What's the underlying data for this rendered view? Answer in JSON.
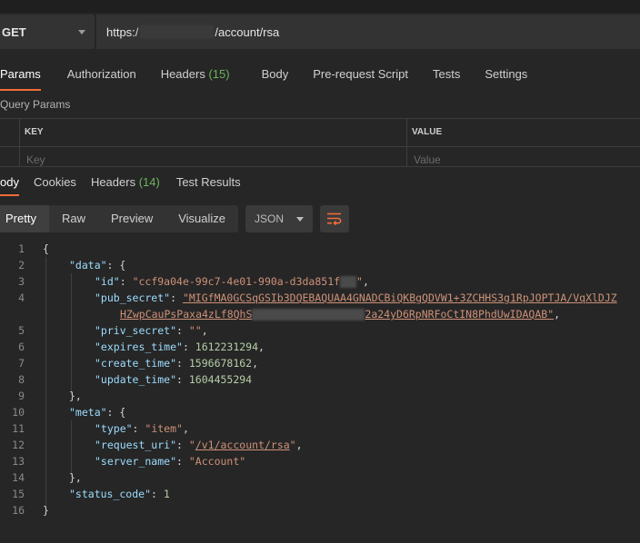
{
  "request": {
    "method": "GET",
    "url_prefix": "https:/",
    "url_suffix": "/account/rsa"
  },
  "request_tabs": [
    {
      "label": "Params",
      "active": true
    },
    {
      "label": "Authorization"
    },
    {
      "label": "Headers",
      "count": "(15)"
    },
    {
      "label": "Body"
    },
    {
      "label": "Pre-request Script"
    },
    {
      "label": "Tests"
    },
    {
      "label": "Settings"
    }
  ],
  "query_params": {
    "title": "Query Params",
    "key_header": "KEY",
    "value_header": "VALUE",
    "key_placeholder": "Key",
    "value_placeholder": "Value"
  },
  "response_tabs": [
    {
      "label": "ody",
      "active": true
    },
    {
      "label": "Cookies"
    },
    {
      "label": "Headers",
      "count": "(14)"
    },
    {
      "label": "Test Results"
    }
  ],
  "view_modes": [
    "Pretty",
    "Raw",
    "Preview",
    "Visualize"
  ],
  "format": "JSON",
  "code": {
    "line_numbers": [
      "1",
      "2",
      "3",
      "4",
      "5",
      "6",
      "7",
      "8",
      "9",
      "10",
      "11",
      "12",
      "13",
      "14",
      "15",
      "16"
    ],
    "l1": "{",
    "l2_key": "\"data\"",
    "l2_rest": ": {",
    "l3_key": "\"id\"",
    "l3_sep": ": ",
    "l3_val_a": "\"ccf9a04e-99c7-4e01-990a-d3da851f",
    "l3_val_b": "\"",
    "l3_end": ",",
    "l4_key": "\"pub_secret\"",
    "l4_sep": ": ",
    "l4_val": "\"MIGfMA0GCSqGSIb3DQEBAQUAA4GNADCBiQKBgQDVW1+3ZCHHS3g1RpJOPTJA/VqXlDJZ",
    "l4b_val_a": "HZwpCauPsPaxa4zLf8QhS",
    "l4b_val_b": "2a24yD6RpNRFoCtIN8PhdUwIDAQAB\"",
    "l4b_end": ",",
    "l5_key": "\"priv_secret\"",
    "l5_sep": ": ",
    "l5_val": "\"\"",
    "l5_end": ",",
    "l6_key": "\"expires_time\"",
    "l6_sep": ": ",
    "l6_val": "1612231294",
    "l6_end": ",",
    "l7_key": "\"create_time\"",
    "l7_sep": ": ",
    "l7_val": "1596678162",
    "l7_end": ",",
    "l8_key": "\"update_time\"",
    "l8_sep": ": ",
    "l8_val": "1604455294",
    "l9": "},",
    "l10_key": "\"meta\"",
    "l10_rest": ": {",
    "l11_key": "\"type\"",
    "l11_sep": ": ",
    "l11_val": "\"item\"",
    "l11_end": ",",
    "l12_key": "\"request_uri\"",
    "l12_sep": ": ",
    "l12_q1": "\"",
    "l12_val": "/v1/account/rsa",
    "l12_q2": "\"",
    "l12_end": ",",
    "l13_key": "\"server_name\"",
    "l13_sep": ": ",
    "l13_val": "\"Account\"",
    "l14": "},",
    "l15_key": "\"status_code\"",
    "l15_sep": ": ",
    "l15_val": "1",
    "l16": "}"
  }
}
